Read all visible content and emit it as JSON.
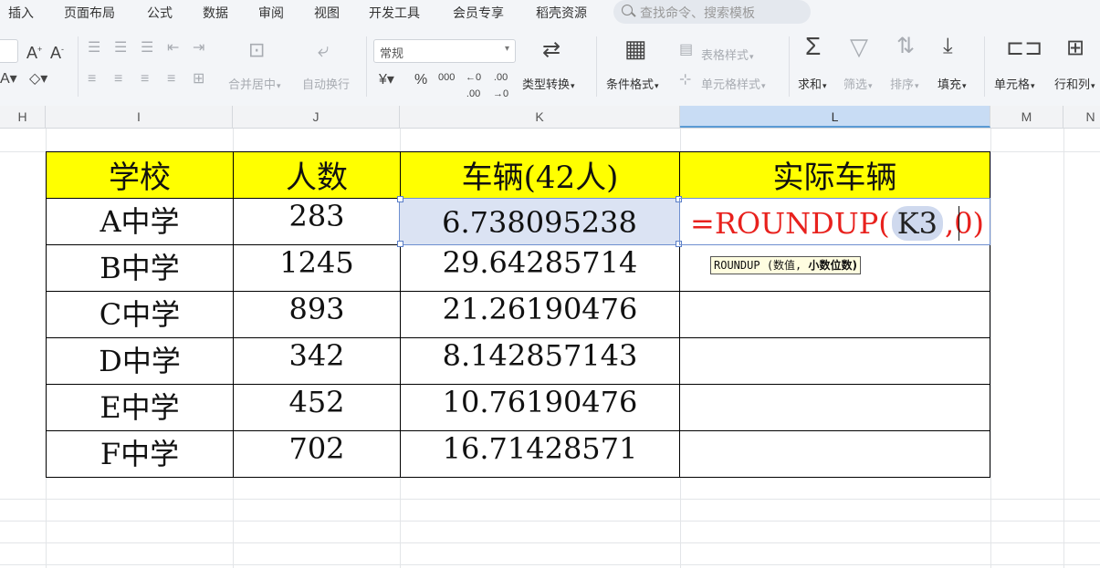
{
  "menu": {
    "items": [
      "插入",
      "页面布局",
      "公式",
      "数据",
      "审阅",
      "视图",
      "开发工具",
      "会员专享",
      "稻壳资源"
    ],
    "search_placeholder": "查找命令、搜索模板"
  },
  "ribbon": {
    "number_format": "常规",
    "merge_center": "合并居中",
    "wrap_text": "自动换行",
    "type_convert": "类型转换",
    "conditional_format": "条件格式",
    "table_style": "表格样式",
    "cell_style": "单元格样式",
    "sum": "求和",
    "filter": "筛选",
    "sort": "排序",
    "fill": "填充",
    "cell": "单元格",
    "row_col": "行和列",
    "currency_symbol": "¥",
    "percent_symbol": "%",
    "thousands_symbol": "000"
  },
  "columns": [
    "H",
    "I",
    "J",
    "K",
    "L",
    "M",
    "N"
  ],
  "table": {
    "headers": [
      "学校",
      "人数",
      "车辆(42人)",
      "实际车辆"
    ],
    "rows": [
      [
        "A中学",
        "283",
        "6.738095238"
      ],
      [
        "B中学",
        "1245",
        "29.64285714"
      ],
      [
        "C中学",
        "893",
        "21.26190476"
      ],
      [
        "D中学",
        "342",
        "8.142857143"
      ],
      [
        "E中学",
        "452",
        "10.76190476"
      ],
      [
        "F中学",
        "702",
        "16.71428571"
      ]
    ]
  },
  "formula": {
    "prefix": "=ROUNDUP(",
    "ref": "K3",
    "rest": ",0)"
  },
  "tooltip": {
    "func": "ROUNDUP",
    "arg1": "(数值,",
    "arg2": "小数位数)"
  },
  "colors": {
    "header_fill": "#ffff00",
    "formula_text": "#e8211d",
    "selection": "#dbe3f3"
  }
}
